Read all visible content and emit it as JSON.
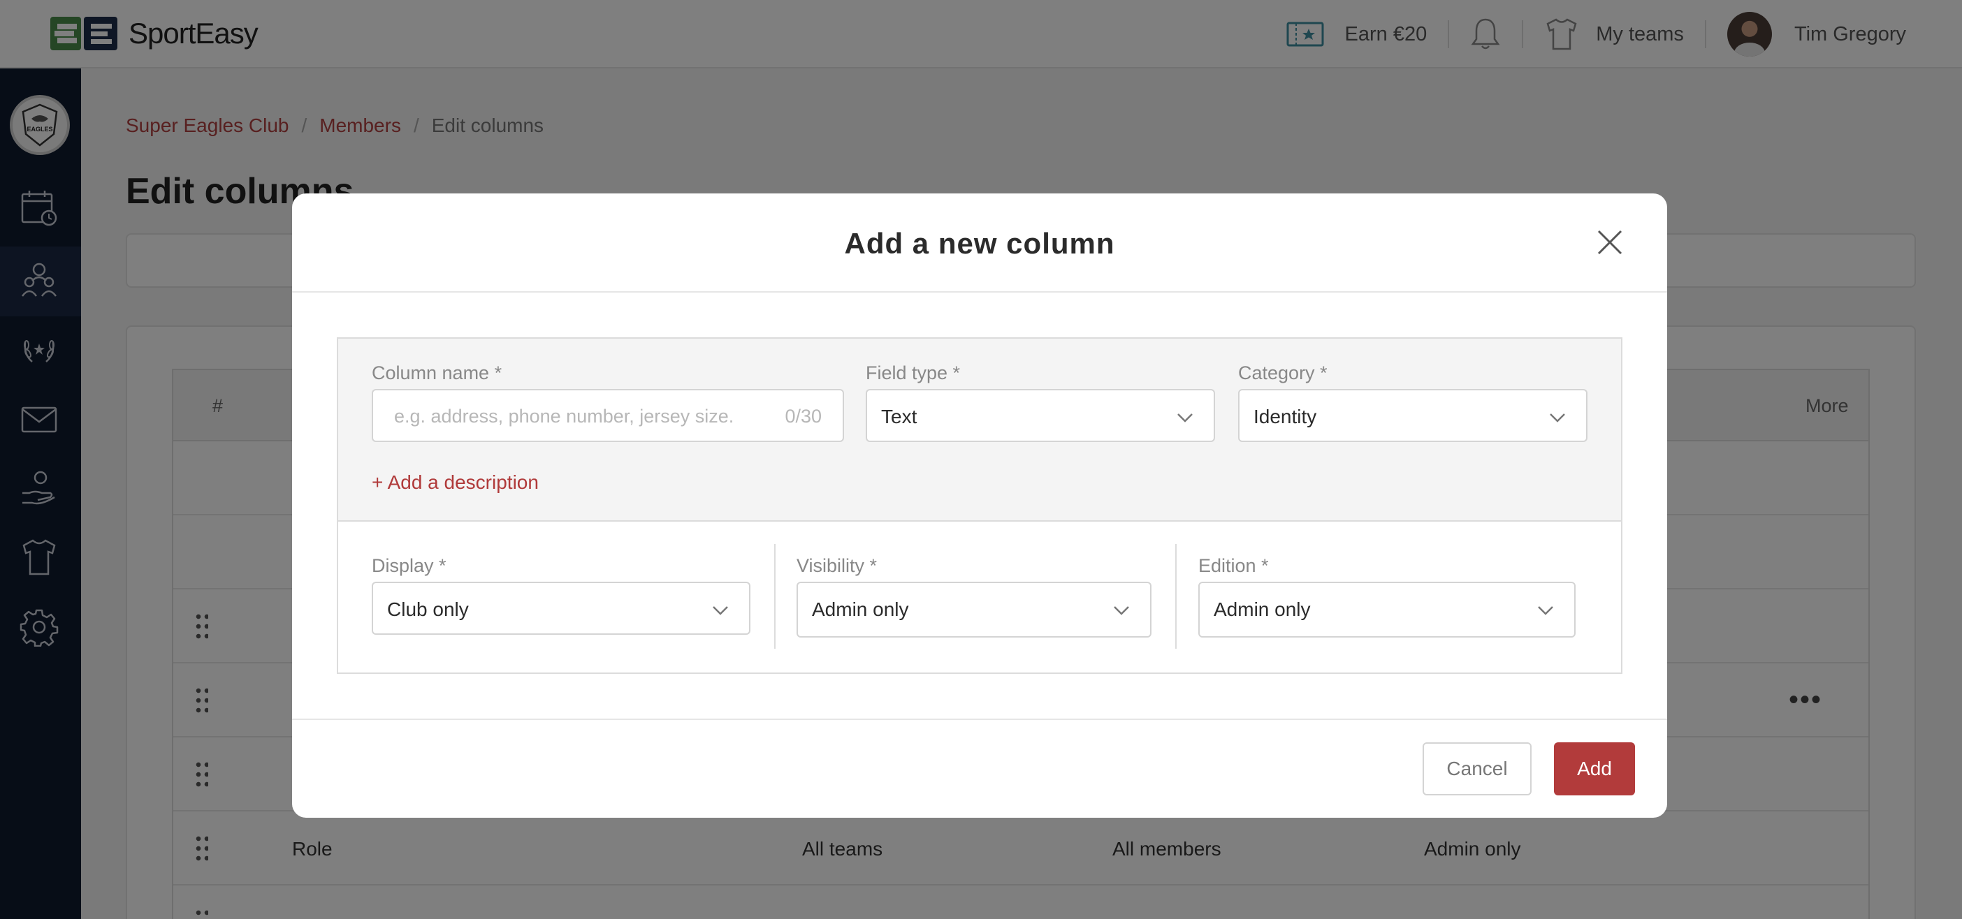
{
  "app": {
    "name": "SportEasy",
    "brand_green": "#4a8c4a",
    "brand_dark": "#1c2c4a",
    "accent": "#b23b3b"
  },
  "topbar": {
    "earn_label": "Earn €20",
    "my_teams_label": "My teams",
    "user_name": "Tim Gregory",
    "icons": [
      "ticket-icon",
      "bell-icon",
      "jersey-icon",
      "avatar"
    ]
  },
  "sidebar": {
    "club_badge": "EAGLES",
    "items": [
      "calendar-icon",
      "members-icon",
      "laurel-icon",
      "mail-icon",
      "hand-heart-icon",
      "jersey-icon",
      "gear-icon"
    ]
  },
  "breadcrumb": {
    "club": "Super Eagles Club",
    "members": "Members",
    "current": "Edit columns"
  },
  "page": {
    "title": "Edit columns"
  },
  "table": {
    "header": {
      "hash": "#",
      "more": "More"
    },
    "role_row": {
      "name": "Role",
      "display": "All teams",
      "visibility": "All members",
      "edition": "Admin only"
    }
  },
  "modal": {
    "title": "Add a new column",
    "column_name": {
      "label": "Column name *",
      "placeholder": "e.g. address, phone number, jersey size.",
      "counter": "0/30"
    },
    "field_type": {
      "label": "Field type *",
      "value": "Text"
    },
    "category": {
      "label": "Category *",
      "value": "Identity"
    },
    "add_description": "+ Add a description",
    "display": {
      "label": "Display *",
      "value": "Club only"
    },
    "visibility": {
      "label": "Visibility *",
      "value": "Admin only"
    },
    "edition": {
      "label": "Edition *",
      "value": "Admin only"
    },
    "cancel_label": "Cancel",
    "add_label": "Add"
  }
}
